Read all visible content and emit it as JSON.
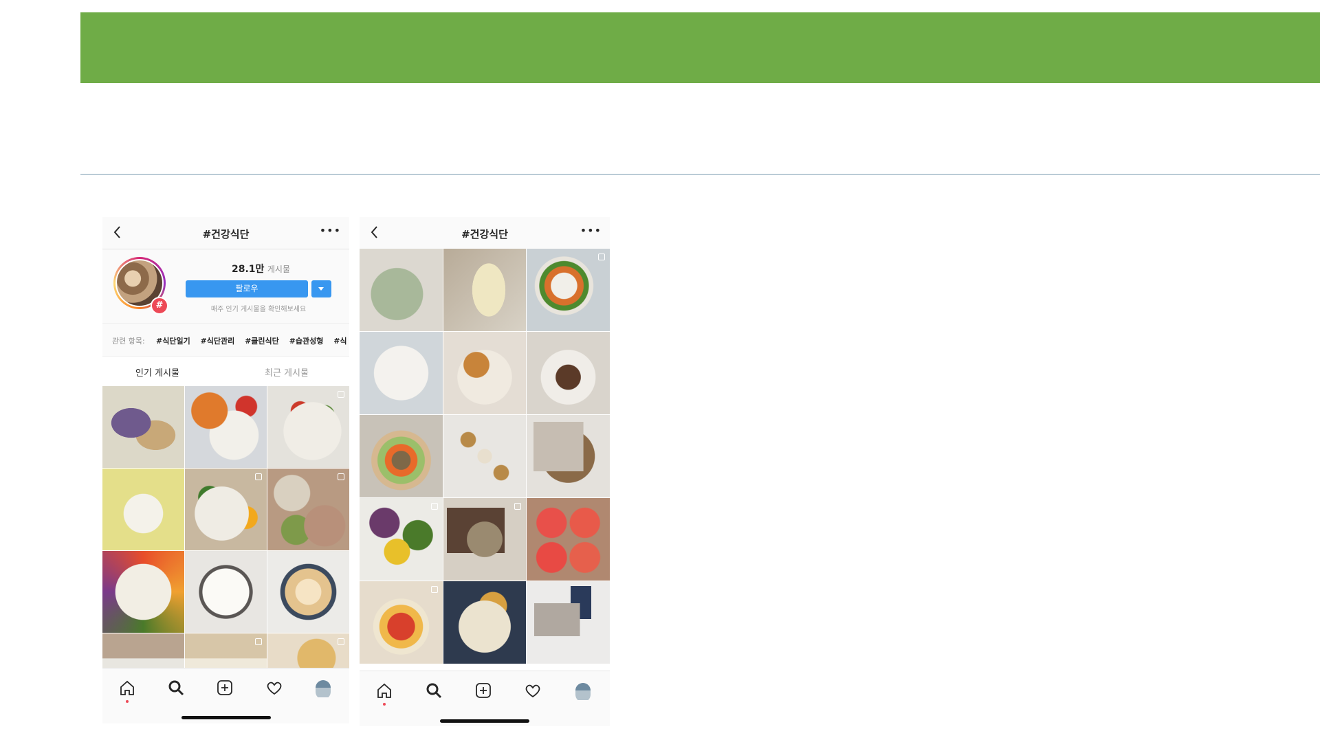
{
  "slide": {
    "banner_color": "#6fac47"
  },
  "left_screen": {
    "title": "#건강식단",
    "post_count_value": "28.1만",
    "post_count_label": "게시물",
    "follow_label": "팔로우",
    "subnote": "매주 인기 게시물을 확인해보세요",
    "related_label": "관련 항목:",
    "related_tags": [
      "#식단일기",
      "#식단관리",
      "#클린식단",
      "#습관성형",
      "#식"
    ],
    "tabs": [
      "인기 게시물",
      "최근 게시물"
    ],
    "active_tab": "인기 게시물",
    "bottom_nav": [
      "home-icon",
      "search-icon",
      "add-post-icon",
      "heart-icon",
      "profile-avatar"
    ]
  },
  "right_screen": {
    "title": "#건강식단",
    "bottom_nav": [
      "home-icon",
      "search-icon",
      "add-post-icon",
      "heart-icon",
      "profile-avatar"
    ]
  },
  "colors": {
    "accent": "#3897f0",
    "notification": "#ed4956"
  }
}
